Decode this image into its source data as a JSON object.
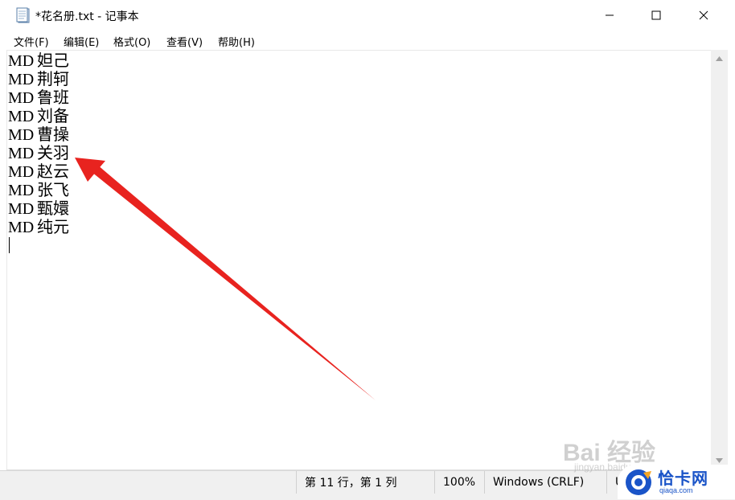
{
  "window": {
    "title": "*花名册.txt - 记事本",
    "icon": "notepad-icon"
  },
  "controls": {
    "minimize_icon": "minimize-icon",
    "maximize_icon": "maximize-icon",
    "close_icon": "close-icon"
  },
  "menu": [
    {
      "label": "文件(F)"
    },
    {
      "label": "编辑(E)"
    },
    {
      "label": "格式(O)"
    },
    {
      "label": "查看(V)"
    },
    {
      "label": "帮助(H)"
    }
  ],
  "editor": {
    "lines": [
      {
        "code": "MD",
        "name": "妲己"
      },
      {
        "code": "MD",
        "name": "荆轲"
      },
      {
        "code": "MD",
        "name": "鲁班"
      },
      {
        "code": "MD",
        "name": "刘备"
      },
      {
        "code": "MD",
        "name": "曹操"
      },
      {
        "code": "MD",
        "name": "关羽"
      },
      {
        "code": "MD",
        "name": "赵云"
      },
      {
        "code": "MD",
        "name": "张飞"
      },
      {
        "code": "MD",
        "name": "甄嬛"
      },
      {
        "code": "MD",
        "name": "纯元"
      }
    ]
  },
  "status": {
    "position": "第 11 行，第 1 列",
    "zoom": "100%",
    "line_ending": "Windows (CRLF)",
    "encoding_partial": "U"
  },
  "watermark": {
    "main": "Bai 经验",
    "sub": "jingyan.baidu.com"
  },
  "brand": {
    "name": "恰卡网",
    "url": "qiaqa.com"
  },
  "colors": {
    "arrow": "#e8231f",
    "brand": "#1a54c8",
    "statusbar": "#f0f0f0"
  }
}
